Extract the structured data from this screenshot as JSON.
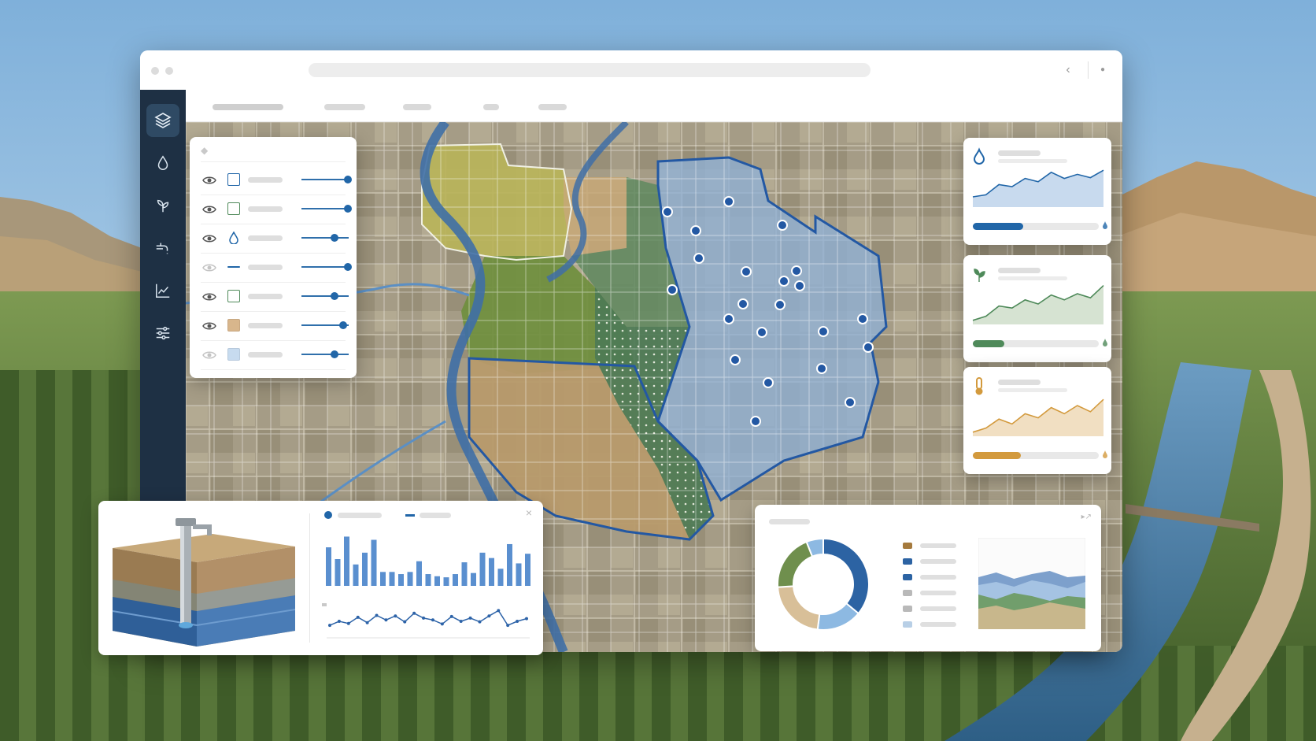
{
  "window": {
    "address_bar": "",
    "tabs": [
      "",
      "",
      "",
      "",
      ""
    ]
  },
  "sidebar": {
    "items": [
      {
        "id": "layers",
        "icon": "layers-icon",
        "active": true
      },
      {
        "id": "water",
        "icon": "water-drop-icon",
        "active": false
      },
      {
        "id": "crops",
        "icon": "plant-icon",
        "active": false
      },
      {
        "id": "irrigation",
        "icon": "faucet-icon",
        "active": false
      },
      {
        "id": "analytics",
        "icon": "line-chart-icon",
        "active": false
      },
      {
        "id": "settings",
        "icon": "sliders-icon",
        "active": false
      }
    ]
  },
  "layers_panel": {
    "items": [
      {
        "visible": true,
        "swatch": "square-outline-blue",
        "color": "#2166a8",
        "opacity": 1.0
      },
      {
        "visible": true,
        "swatch": "square-outline-green",
        "color": "#4f8a5a",
        "opacity": 1.0
      },
      {
        "visible": true,
        "swatch": "water-drop-icon",
        "color": "#2166a8",
        "opacity": 0.7
      },
      {
        "visible": false,
        "swatch": "line",
        "color": "#2166a8",
        "opacity": 1.0
      },
      {
        "visible": true,
        "swatch": "square-outline-green",
        "color": "#4f8a5a",
        "opacity": 0.7
      },
      {
        "visible": true,
        "swatch": "square-fill-tan",
        "color": "#d8b68c",
        "opacity": 0.9
      },
      {
        "visible": false,
        "swatch": "square-fill-lightblue",
        "color": "#c7dbef",
        "opacity": 0.7
      }
    ]
  },
  "metric_cards": [
    {
      "icon": "water-drop-icon",
      "color": "#2166a8",
      "fill": "#c8daee",
      "progress": 0.4,
      "series": [
        0.25,
        0.3,
        0.55,
        0.5,
        0.7,
        0.62,
        0.85,
        0.7,
        0.8,
        0.72,
        0.9
      ]
    },
    {
      "icon": "plant-icon",
      "color": "#4f8a5a",
      "fill": "#d6e3d2",
      "progress": 0.25,
      "series": [
        0.1,
        0.2,
        0.45,
        0.4,
        0.6,
        0.5,
        0.72,
        0.6,
        0.75,
        0.65,
        0.95
      ]
    },
    {
      "icon": "thermometer-icon",
      "color": "#d39a3d",
      "fill": "#f1dfc2",
      "progress": 0.38,
      "series": [
        0.1,
        0.2,
        0.42,
        0.3,
        0.55,
        0.45,
        0.7,
        0.55,
        0.75,
        0.6,
        0.9
      ]
    }
  ],
  "well_panel": {
    "icon": "groundwater-well-icon",
    "legend": [
      "",
      ""
    ],
    "bar_series": [
      0.72,
      0.5,
      0.92,
      0.4,
      0.62,
      0.86,
      0.26,
      0.26,
      0.22,
      0.26,
      0.46,
      0.22,
      0.18,
      0.16,
      0.22,
      0.44,
      0.24,
      0.62,
      0.52,
      0.32,
      0.78,
      0.42,
      0.6
    ],
    "line_series": [
      0.35,
      0.5,
      0.42,
      0.65,
      0.45,
      0.72,
      0.55,
      0.7,
      0.48,
      0.8,
      0.62,
      0.55,
      0.4,
      0.68,
      0.5,
      0.62,
      0.48,
      0.7,
      0.9,
      0.35,
      0.5,
      0.6
    ]
  },
  "composition_panel": {
    "donut": [
      {
        "value": 0.36,
        "color": "#2c63a3"
      },
      {
        "value": 0.16,
        "color": "#8db9e2"
      },
      {
        "value": 0.22,
        "color": "#d8bf98"
      },
      {
        "value": 0.2,
        "color": "#6f8f4d"
      },
      {
        "value": 0.06,
        "color": "#8db9e2"
      }
    ],
    "legend_colors": [
      "#a57a3d",
      "#2c63a3",
      "#2c63a3",
      "#b9b9b9",
      "#b9b9b9",
      "#b8cfe6"
    ],
    "stack_colors": [
      "#d2b990",
      "#6c9a5e",
      "#aac7e6",
      "#6f96c6"
    ]
  }
}
